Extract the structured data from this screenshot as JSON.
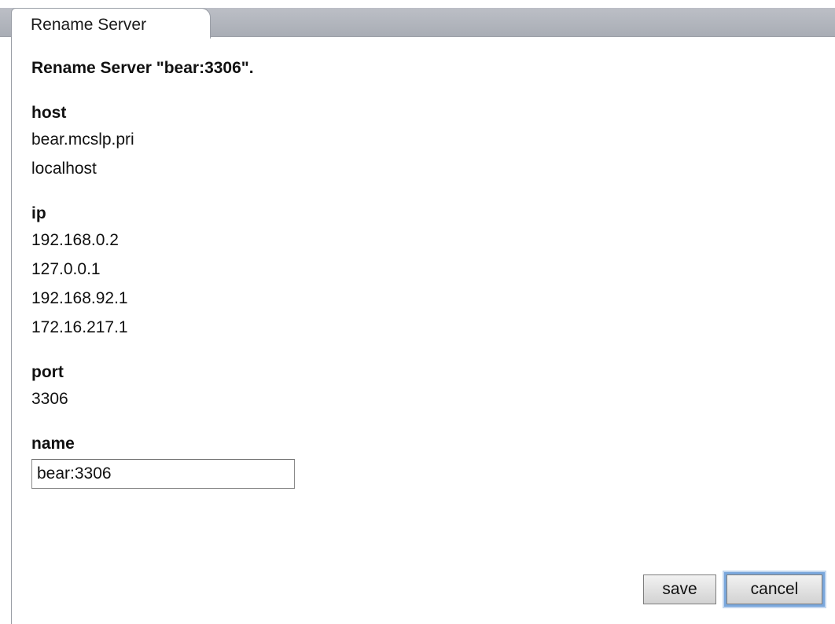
{
  "tab": {
    "label": "Rename Server"
  },
  "heading": "Rename Server \"bear:3306\".",
  "fields": {
    "host": {
      "label": "host",
      "values": [
        "bear.mcslp.pri",
        "localhost"
      ]
    },
    "ip": {
      "label": "ip",
      "values": [
        "192.168.0.2",
        "127.0.0.1",
        "192.168.92.1",
        "172.16.217.1"
      ]
    },
    "port": {
      "label": "port",
      "values": [
        "3306"
      ]
    },
    "name": {
      "label": "name",
      "value": "bear:3306"
    }
  },
  "buttons": {
    "save_label": "save",
    "cancel_label": "cancel"
  },
  "colors": {
    "tabbar": "#afb3ba",
    "focus_ring": "#7aa7dc"
  }
}
